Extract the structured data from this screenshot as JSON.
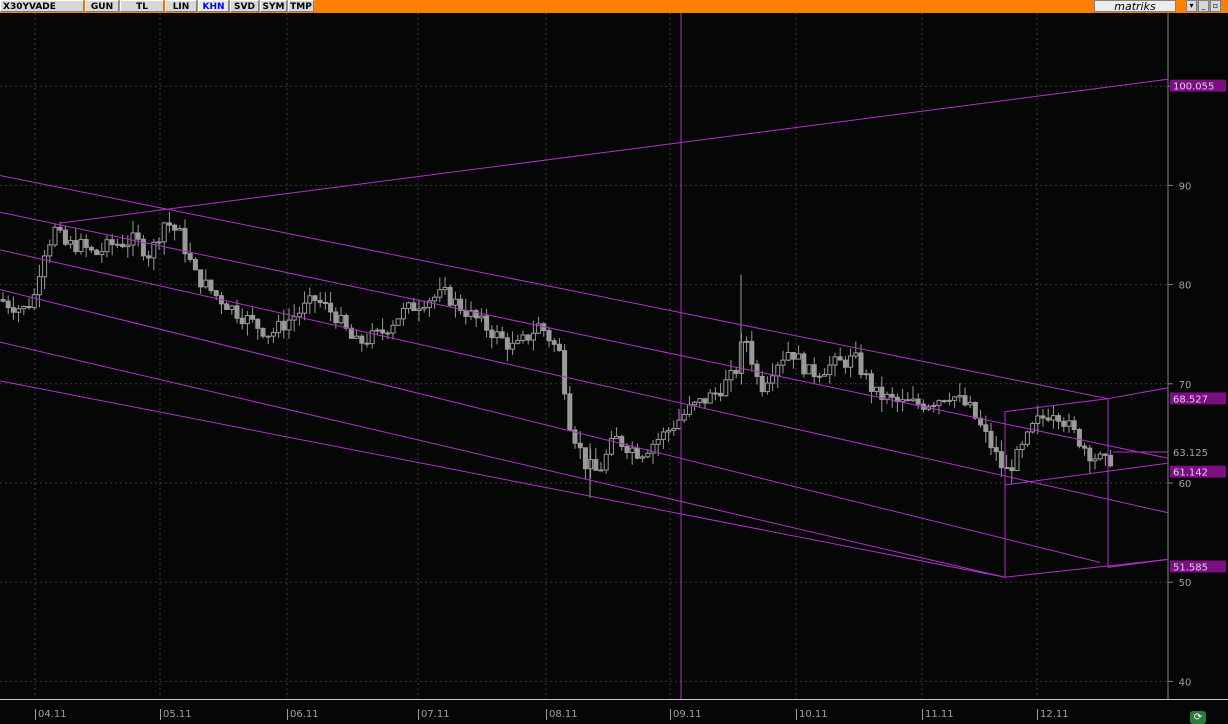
{
  "toolbar": {
    "symbol": "X30YVADE",
    "buttons": [
      {
        "label": "GUN",
        "active": false
      },
      {
        "label": "TL",
        "active": false
      },
      {
        "label": "LIN",
        "active": false
      },
      {
        "label": "KHN",
        "active": true
      },
      {
        "label": "SVD",
        "active": false
      },
      {
        "label": "SYM",
        "active": false
      },
      {
        "label": "TMP",
        "active": false
      }
    ],
    "brand": "matriks",
    "window_buttons": [
      "▾",
      "_",
      "▫"
    ]
  },
  "colors": {
    "background": "#060606",
    "grid": "#3a3a3a",
    "candle": "#9a9a9a",
    "channel": "#b030c8",
    "price_tag": "#7a0e82",
    "axis": "#a0a0a0",
    "toolbar": "#ff7f00"
  },
  "chart_data": {
    "type": "candlestick",
    "x_labels": [
      "04.11",
      "05.11",
      "06.11",
      "07.11",
      "08.11",
      "09.11",
      "10.11",
      "11.11",
      "12.11"
    ],
    "y_ticks": [
      40,
      50,
      60,
      70,
      80,
      90,
      100
    ],
    "y_range": [
      38.5,
      105
    ],
    "grid": true,
    "price_tags": [
      {
        "label": "100.055",
        "value": 100.055,
        "highlight": true
      },
      {
        "label": "68.527",
        "value": 68.527,
        "highlight": true
      },
      {
        "label": "63.125",
        "value": 63.125,
        "highlight": false
      },
      {
        "label": "61.142",
        "value": 61.142,
        "highlight": true
      },
      {
        "label": "51.585",
        "value": 51.585,
        "highlight": true
      }
    ],
    "close_path": [
      [
        0,
        78.5
      ],
      [
        10,
        78
      ],
      [
        25,
        77.5
      ],
      [
        35,
        79
      ],
      [
        42,
        83
      ],
      [
        55,
        85.5
      ],
      [
        65,
        84
      ],
      [
        80,
        84
      ],
      [
        95,
        83
      ],
      [
        110,
        84
      ],
      [
        135,
        84.5
      ],
      [
        150,
        83
      ],
      [
        165,
        86.5
      ],
      [
        180,
        85
      ],
      [
        195,
        81
      ],
      [
        215,
        79
      ],
      [
        240,
        77
      ],
      [
        270,
        75
      ],
      [
        290,
        76.5
      ],
      [
        315,
        78.5
      ],
      [
        335,
        77
      ],
      [
        355,
        74
      ],
      [
        380,
        75
      ],
      [
        400,
        77
      ],
      [
        425,
        78.5
      ],
      [
        445,
        79
      ],
      [
        470,
        77
      ],
      [
        495,
        75
      ],
      [
        515,
        73.5
      ],
      [
        540,
        76
      ],
      [
        560,
        73
      ],
      [
        570,
        66
      ],
      [
        585,
        62
      ],
      [
        598,
        61
      ],
      [
        615,
        64.5
      ],
      [
        640,
        63
      ],
      [
        665,
        65
      ],
      [
        690,
        67.5
      ],
      [
        715,
        69
      ],
      [
        735,
        71
      ],
      [
        745,
        75
      ],
      [
        760,
        69.5
      ],
      [
        775,
        72
      ],
      [
        790,
        73.5
      ],
      [
        810,
        71
      ],
      [
        835,
        72
      ],
      [
        855,
        72.5
      ],
      [
        875,
        69
      ],
      [
        900,
        68
      ],
      [
        925,
        68
      ],
      [
        950,
        69
      ],
      [
        970,
        67.5
      ],
      [
        990,
        64
      ],
      [
        1005,
        61
      ],
      [
        1020,
        63
      ],
      [
        1035,
        66
      ],
      [
        1055,
        67.5
      ],
      [
        1070,
        65.5
      ],
      [
        1090,
        63
      ],
      [
        1105,
        62
      ],
      [
        1113,
        62.6
      ]
    ],
    "spikes": [
      {
        "x": 741,
        "high": 81,
        "low": 71
      },
      {
        "x": 590,
        "high": 64,
        "low": 58.5
      }
    ],
    "vertical_line_x": 681,
    "channel_lines": [
      {
        "x1": 0,
        "y1": 91,
        "x2": 1108,
        "y2": 68.5
      },
      {
        "x1": 0,
        "y1": 87.3,
        "x2": 1168,
        "y2": 62.5
      },
      {
        "x1": 0,
        "y1": 83.5,
        "x2": 1168,
        "y2": 57
      },
      {
        "x1": 0,
        "y1": 79.5,
        "x2": 1100,
        "y2": 52
      },
      {
        "x1": 0,
        "y1": 74.2,
        "x2": 1005,
        "y2": 50.5
      },
      {
        "x1": 0,
        "y1": 70.3,
        "x2": 1005,
        "y2": 50.5
      },
      {
        "x1": 60,
        "y1": 86.2,
        "x2": 1168,
        "y2": 100.7
      },
      {
        "x1": 1005,
        "y1": 67.2,
        "x2": 1108,
        "y2": 68.5
      },
      {
        "x1": 1005,
        "y1": 59.8,
        "x2": 1168,
        "y2": 62
      },
      {
        "x1": 1005,
        "y1": 50.5,
        "x2": 1168,
        "y2": 52.3
      },
      {
        "x1": 1108,
        "y1": 68.5,
        "x2": 1168,
        "y2": 69.6
      },
      {
        "x1": 1108,
        "y1": 51.5,
        "x2": 1168,
        "y2": 52.3
      },
      {
        "x1": 1005,
        "y1": 67.2,
        "x2": 1005,
        "y2": 50.5
      },
      {
        "x1": 1108,
        "y1": 68.5,
        "x2": 1108,
        "y2": 51.5
      }
    ]
  }
}
